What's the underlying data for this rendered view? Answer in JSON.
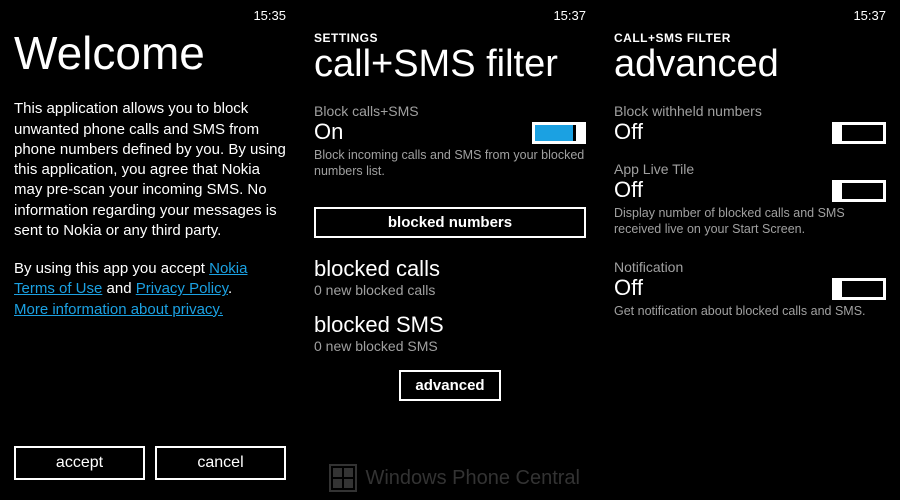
{
  "screen1": {
    "time": "15:35",
    "title": "Welcome",
    "para1": "This application allows you to block unwanted phone calls and SMS from phone numbers defined by you. By using this application, you agree that Nokia may pre-scan your incoming SMS. No information regarding your messages is sent to Nokia or any third party.",
    "para2_prefix": "By using this app you accept ",
    "link_terms": "Nokia Terms of Use",
    "para2_mid": " and ",
    "link_privacy": "Privacy Policy",
    "para2_suffix": ".",
    "link_more": "More information about privacy.",
    "accept": "accept",
    "cancel": "cancel"
  },
  "screen2": {
    "time": "15:37",
    "section": "SETTINGS",
    "title": "call+SMS filter",
    "block_label": "Block calls+SMS",
    "block_value": "On",
    "block_desc": "Block incoming calls and SMS from your blocked numbers list.",
    "btn_blocked_numbers": "blocked numbers",
    "blocked_calls_heading": "blocked calls",
    "blocked_calls_sub": "0 new blocked calls",
    "blocked_sms_heading": "blocked SMS",
    "blocked_sms_sub": "0 new blocked SMS",
    "btn_advanced": "advanced"
  },
  "screen3": {
    "time": "15:37",
    "section": "CALL+SMS FILTER",
    "title": "advanced",
    "s1_label": "Block withheld numbers",
    "s1_value": "Off",
    "s2_label": "App Live Tile",
    "s2_value": "Off",
    "s2_desc": "Display number of blocked calls and SMS received live on your Start Screen.",
    "s3_label": "Notification",
    "s3_value": "Off",
    "s3_desc": "Get notification about blocked calls and SMS."
  },
  "watermark": "Windows Phone Central"
}
